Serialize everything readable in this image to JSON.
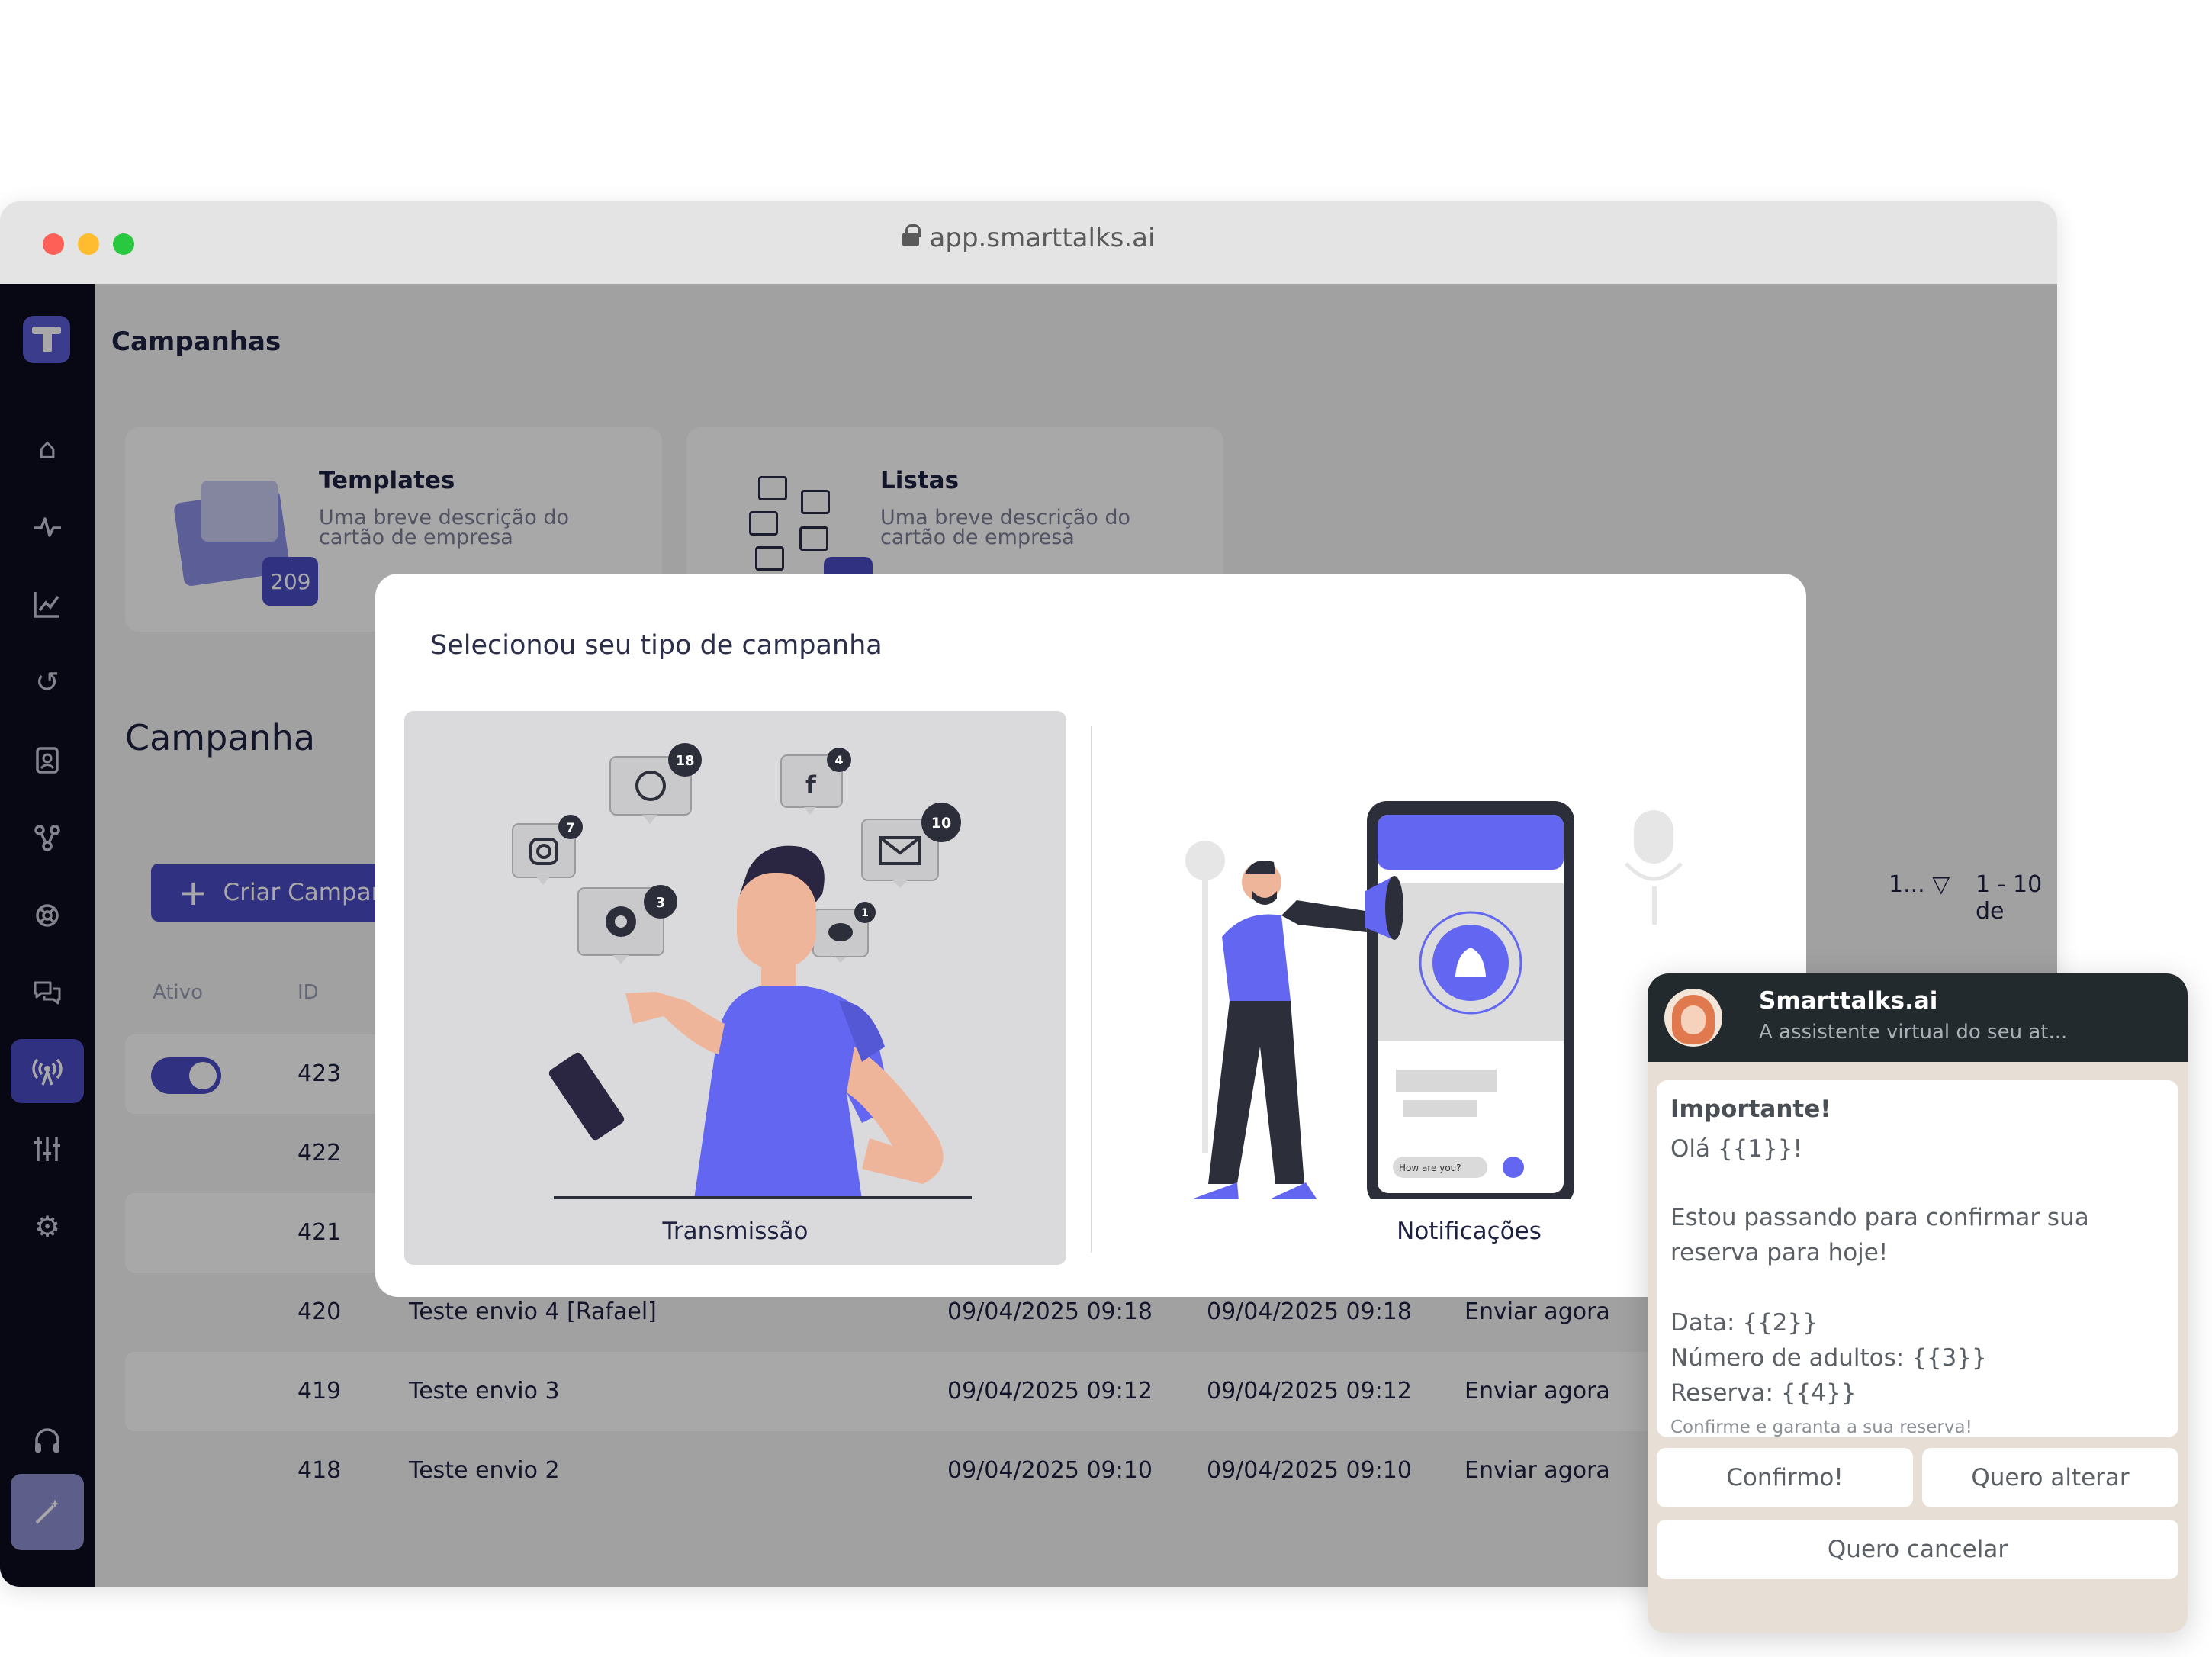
{
  "browser": {
    "url": "app.smarttalks.ai"
  },
  "page": {
    "title": "Campanhas"
  },
  "cards": [
    {
      "title": "Templates",
      "description": "Uma breve descrição do cartão de empresa",
      "count": "209"
    },
    {
      "title": "Listas",
      "description": "Uma breve descrição do cartão de empresa",
      "count": ""
    }
  ],
  "section": {
    "title": "Campanha",
    "create_label": "Criar Campanha",
    "per_page": "1...",
    "range": "1 - 10 de"
  },
  "table": {
    "headers": {
      "active": "Ativo",
      "id": "ID"
    },
    "rows": [
      {
        "id": "423",
        "name": "",
        "date1": "",
        "date2": "",
        "action": ""
      },
      {
        "id": "422",
        "name": "",
        "date1": "",
        "date2": "",
        "action": ""
      },
      {
        "id": "421",
        "name": "",
        "date1": "",
        "date2": "",
        "action": ""
      },
      {
        "id": "420",
        "name": "Teste envio 4 [Rafael]",
        "date1": "09/04/2025 09:18",
        "date2": "09/04/2025 09:18",
        "action": "Enviar agora"
      },
      {
        "id": "419",
        "name": "Teste envio 3",
        "date1": "09/04/2025 09:12",
        "date2": "09/04/2025 09:12",
        "action": "Enviar agora"
      },
      {
        "id": "418",
        "name": "Teste envio 2",
        "date1": "09/04/2025 09:10",
        "date2": "09/04/2025 09:10",
        "action": "Enviar agora"
      }
    ]
  },
  "modal": {
    "title": "Selecionou seu tipo de campanha",
    "options": [
      {
        "label": "Transmissão",
        "selected": true
      },
      {
        "label": "Notificações",
        "selected": false
      }
    ],
    "social_badges": {
      "whatsapp": "18",
      "facebook": "4",
      "instagram": "7",
      "mail": "10",
      "settings": "3",
      "chat": "1"
    },
    "phone_input": "How are you?"
  },
  "chat": {
    "name": "Smarttalks.ai",
    "subtitle": "A assistente virtual do seu at...",
    "message": {
      "title": "Importante!",
      "greeting": "Olá {{1}}!",
      "line1": "Estou passando para confirmar sua",
      "line2": "reserva para hoje!",
      "date": "Data: {{2}}",
      "adults": "Número de adultos: {{3}}",
      "reservation": "Reserva: {{4}}",
      "footer": "Confirme e garanta a sua reserva!"
    },
    "buttons": {
      "confirm": "Confirmo!",
      "change": "Quero alterar",
      "cancel": "Quero cancelar"
    }
  },
  "sidebar": {
    "icons": [
      "home-icon",
      "activity-icon",
      "chart-icon",
      "history-icon",
      "contacts-icon",
      "flow-icon",
      "integrations-icon",
      "chat-icon",
      "broadcast-icon",
      "sliders-icon",
      "settings-icon",
      "headset-icon",
      "magic-wand-icon"
    ]
  },
  "colors": {
    "accent": "#4b4bc4",
    "sidebar": "#0b0d1f",
    "chat_header": "#232a2e"
  }
}
